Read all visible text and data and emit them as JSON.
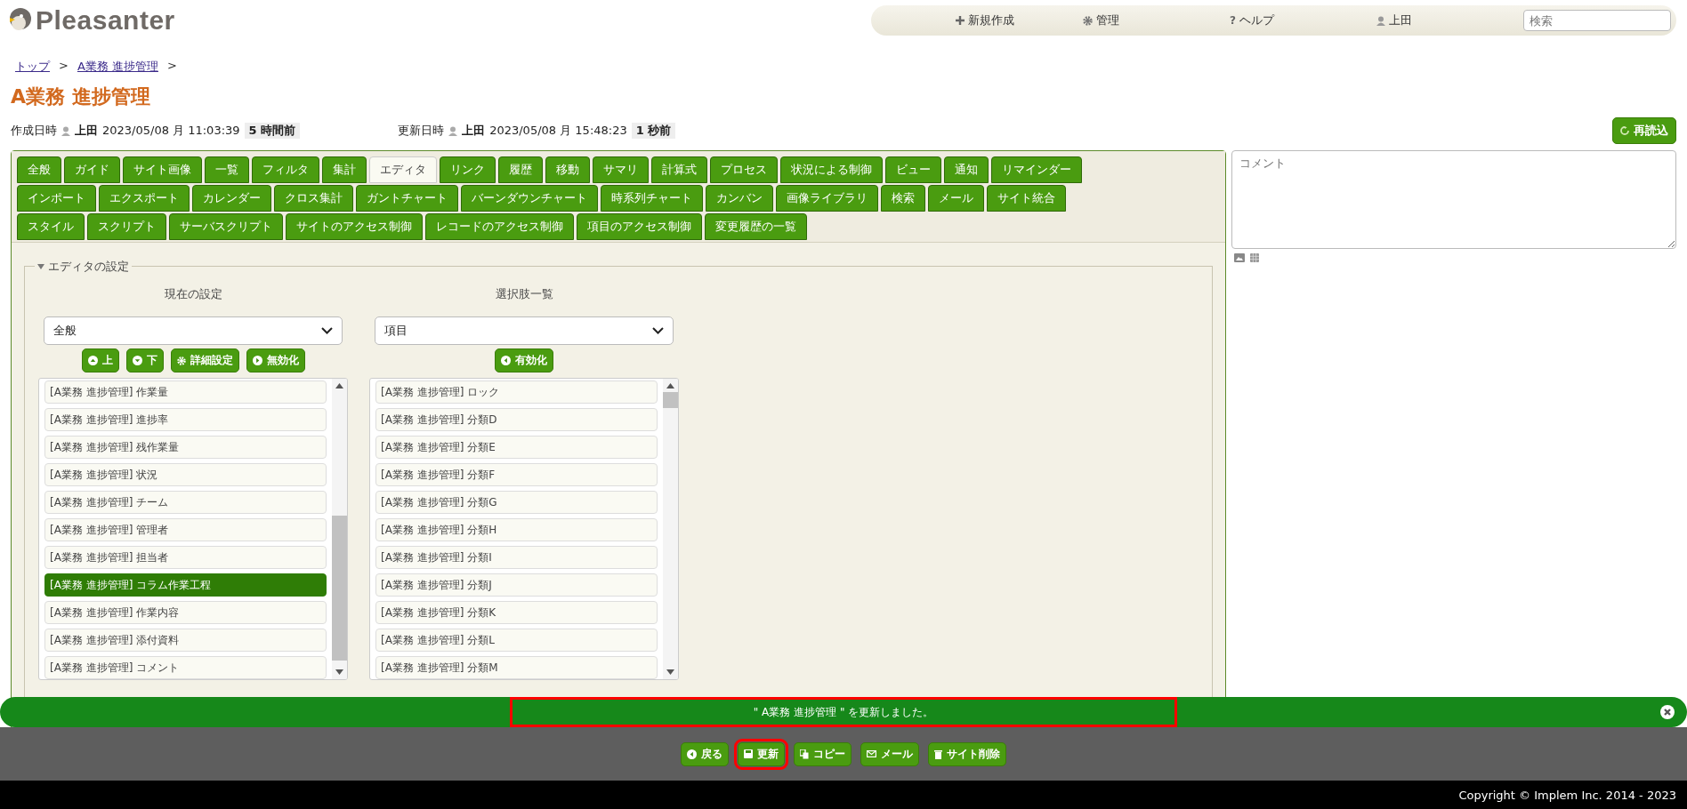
{
  "header": {
    "logo": "Pleasanter",
    "nav": [
      {
        "kind": "new",
        "label": "新規作成"
      },
      {
        "kind": "admin",
        "label": "管理"
      },
      {
        "kind": "help",
        "glyph": "?",
        "label": "ヘルプ"
      },
      {
        "kind": "user",
        "label": "上田"
      }
    ],
    "search": {
      "placeholder": "検索"
    }
  },
  "breadcrumb": [
    {
      "label": "トップ",
      "sep": ">"
    },
    {
      "label": "A業務 進捗管理",
      "sep": ">"
    }
  ],
  "title": "A業務 進捗管理",
  "meta": [
    {
      "label": "作成日時",
      "user": "上田",
      "datetime": "2023/05/08 月 11:03:39",
      "ago": "5 時間前"
    },
    {
      "label": "更新日時",
      "user": "上田",
      "datetime": "2023/05/08 月 15:48:23",
      "ago": "1 秒前"
    }
  ],
  "reload_button": "再読込",
  "tabs": [
    [
      {
        "label": "全般",
        "selected": false
      },
      {
        "label": "ガイド",
        "selected": false
      },
      {
        "label": "サイト画像",
        "selected": false
      },
      {
        "label": "一覧",
        "selected": false
      },
      {
        "label": "フィルタ",
        "selected": false
      },
      {
        "label": "集計",
        "selected": false
      },
      {
        "label": "エディタ",
        "selected": true
      },
      {
        "label": "リンク",
        "selected": false
      },
      {
        "label": "履歴",
        "selected": false
      },
      {
        "label": "移動",
        "selected": false
      },
      {
        "label": "サマリ",
        "selected": false
      },
      {
        "label": "計算式",
        "selected": false
      },
      {
        "label": "プロセス",
        "selected": false
      },
      {
        "label": "状況による制御",
        "selected": false
      },
      {
        "label": "ビュー",
        "selected": false
      },
      {
        "label": "通知",
        "selected": false
      },
      {
        "label": "リマインダー",
        "selected": false
      }
    ],
    [
      {
        "label": "インポート",
        "selected": false
      },
      {
        "label": "エクスポート",
        "selected": false
      },
      {
        "label": "カレンダー",
        "selected": false
      },
      {
        "label": "クロス集計",
        "selected": false
      },
      {
        "label": "ガントチャート",
        "selected": false
      },
      {
        "label": "バーンダウンチャート",
        "selected": false
      },
      {
        "label": "時系列チャート",
        "selected": false
      },
      {
        "label": "カンバン",
        "selected": false
      },
      {
        "label": "画像ライブラリ",
        "selected": false
      },
      {
        "label": "検索",
        "selected": false
      },
      {
        "label": "メール",
        "selected": false
      },
      {
        "label": "サイト統合",
        "selected": false
      }
    ],
    [
      {
        "label": "スタイル",
        "selected": false
      },
      {
        "label": "スクリプト",
        "selected": false
      },
      {
        "label": "サーバスクリプト",
        "selected": false
      },
      {
        "label": "サイトのアクセス制御",
        "selected": false
      },
      {
        "label": "レコードのアクセス制御",
        "selected": false
      },
      {
        "label": "項目のアクセス制御",
        "selected": false
      },
      {
        "label": "変更履歴の一覧",
        "selected": false
      }
    ]
  ],
  "editor_settings": {
    "legend": "エディタの設定",
    "expanded": true,
    "current": {
      "heading": "現在の設定",
      "select": "全般",
      "buttons": [
        {
          "kind": "up",
          "label": "上"
        },
        {
          "kind": "down",
          "label": "下"
        },
        {
          "kind": "settings",
          "label": "詳細設定"
        },
        {
          "kind": "disable",
          "label": "無効化"
        }
      ],
      "items": [
        {
          "label": "[A業務 進捗管理] 作業量",
          "selected": false
        },
        {
          "label": "[A業務 進捗管理] 進捗率",
          "selected": false
        },
        {
          "label": "[A業務 進捗管理] 残作業量",
          "selected": false
        },
        {
          "label": "[A業務 進捗管理] 状況",
          "selected": false
        },
        {
          "label": "[A業務 進捗管理] チーム",
          "selected": false
        },
        {
          "label": "[A業務 進捗管理] 管理者",
          "selected": false
        },
        {
          "label": "[A業務 進捗管理] 担当者",
          "selected": false
        },
        {
          "label": "[A業務 進捗管理] コラム作業工程",
          "selected": true
        },
        {
          "label": "[A業務 進捗管理] 作業内容",
          "selected": false
        },
        {
          "label": "[A業務 進捗管理] 添付資料",
          "selected": false
        },
        {
          "label": "[A業務 進捗管理] コメント",
          "selected": false
        }
      ]
    },
    "choices": {
      "heading": "選択肢一覧",
      "select": "項目",
      "buttons": [
        {
          "kind": "enable",
          "label": "有効化"
        }
      ],
      "items": [
        {
          "label": "[A業務 進捗管理] ロック",
          "selected": false
        },
        {
          "label": "[A業務 進捗管理] 分類D",
          "selected": false
        },
        {
          "label": "[A業務 進捗管理] 分類E",
          "selected": false
        },
        {
          "label": "[A業務 進捗管理] 分類F",
          "selected": false
        },
        {
          "label": "[A業務 進捗管理] 分類G",
          "selected": false
        },
        {
          "label": "[A業務 進捗管理] 分類H",
          "selected": false
        },
        {
          "label": "[A業務 進捗管理] 分類I",
          "selected": false
        },
        {
          "label": "[A業務 進捗管理] 分類J",
          "selected": false
        },
        {
          "label": "[A業務 進捗管理] 分類K",
          "selected": false
        },
        {
          "label": "[A業務 進捗管理] 分類L",
          "selected": false
        },
        {
          "label": "[A業務 進捗管理] 分類M",
          "selected": false
        }
      ]
    }
  },
  "comment": {
    "placeholder": "コメント"
  },
  "notification": {
    "message": "\" A業務 進捗管理 \" を更新しました。"
  },
  "commands": [
    {
      "kind": "back",
      "label": "戻る",
      "highlighted": false
    },
    {
      "kind": "update",
      "label": "更新",
      "highlighted": true
    },
    {
      "kind": "copy",
      "label": "コピー",
      "highlighted": false
    },
    {
      "kind": "mail",
      "label": "メール",
      "highlighted": false
    },
    {
      "kind": "delete",
      "label": "サイト削除",
      "highlighted": false
    }
  ],
  "footer": "Copyright © Implem Inc. 2014 - 2023"
}
